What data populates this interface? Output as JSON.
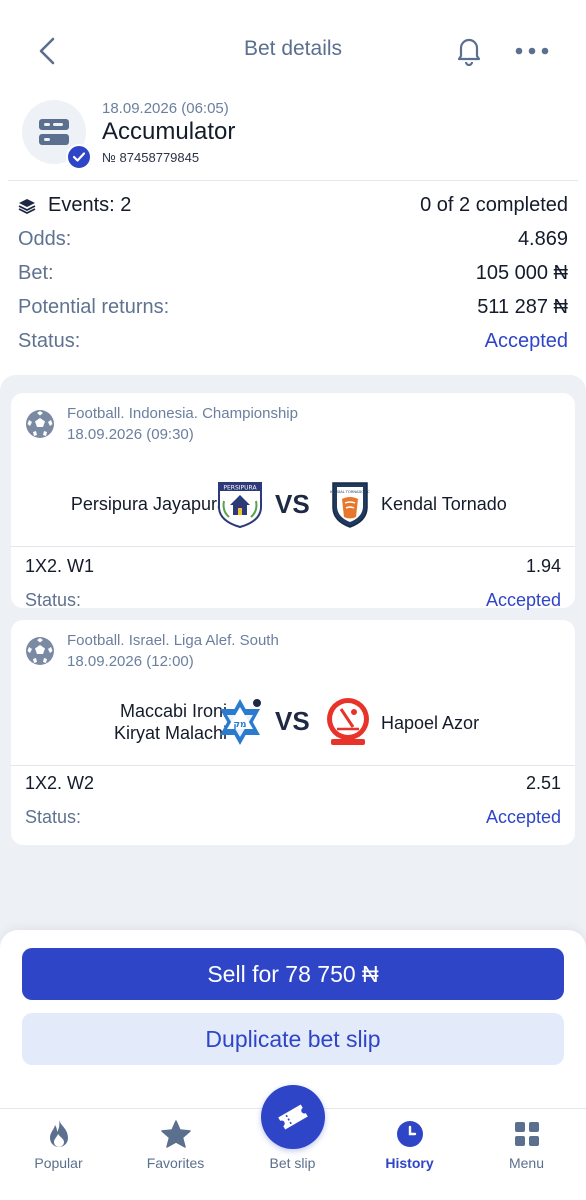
{
  "header": {
    "title": "Bet details"
  },
  "bet": {
    "date": "18.09.2026 (06:05)",
    "type": "Accumulator",
    "number": "№ 87458779845"
  },
  "summary": {
    "events_label": "Events: 2",
    "events_value": "0 of 2 completed",
    "odds_label": "Odds:",
    "odds_value": "4.869",
    "bet_label": "Bet:",
    "bet_value": "105 000 ₦",
    "returns_label": "Potential returns:",
    "returns_value": "511 287 ₦",
    "status_label": "Status:",
    "status_value": "Accepted"
  },
  "events": [
    {
      "league": "Football. Indonesia. Championship",
      "date": "18.09.2026 (09:30)",
      "team_home": "Persipura Jayapura",
      "team_away": "Kendal Tornado",
      "vs": "VS",
      "market": "1X2. W1",
      "odd": "1.94",
      "status_label": "Status:",
      "status": "Accepted"
    },
    {
      "league": "Football. Israel. Liga Alef. South",
      "date": "18.09.2026 (12:00)",
      "team_home_line1": "Maccabi Ironi",
      "team_home_line2": "Kiryat Malachi",
      "team_away": "Hapoel Azor",
      "vs": "VS",
      "market": "1X2. W2",
      "odd": "2.51",
      "status_label": "Status:",
      "status": "Accepted"
    }
  ],
  "actions": {
    "sell_label": "Sell for 78 750 ₦",
    "duplicate_label": "Duplicate bet slip"
  },
  "tabs": [
    {
      "label": "Popular",
      "icon": "flame-icon"
    },
    {
      "label": "Favorites",
      "icon": "star-icon"
    },
    {
      "label": "Bet slip",
      "icon": "ticket-icon"
    },
    {
      "label": "History",
      "icon": "clock-icon",
      "active": true
    },
    {
      "label": "Menu",
      "icon": "grid-icon"
    }
  ],
  "colors": {
    "accent": "#2f45c8",
    "muted": "#5f7391",
    "background": "#edf0f5"
  }
}
